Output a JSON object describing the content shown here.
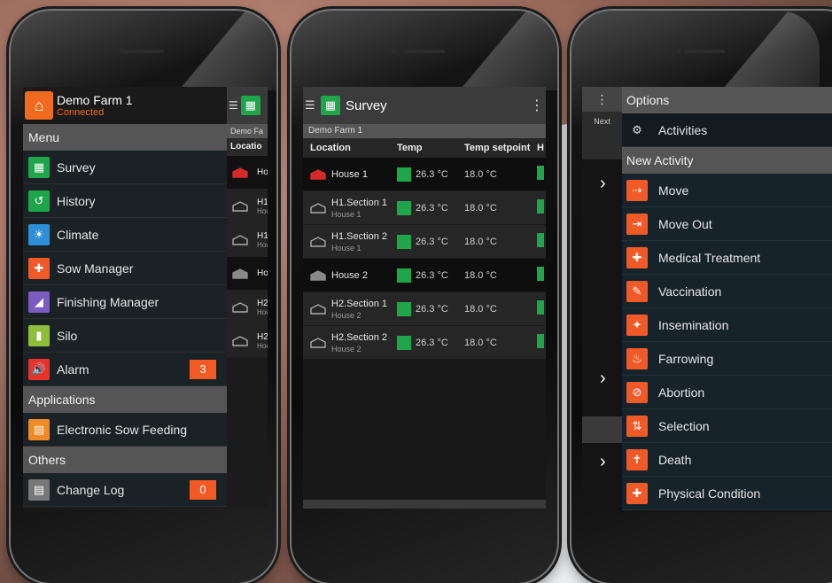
{
  "phone1": {
    "farm_name": "Demo Farm 1",
    "status": "Connected",
    "sections": [
      {
        "title": "Menu",
        "items": [
          {
            "label": "Survey",
            "icon": "grid-icon",
            "color": "#1fa64a"
          },
          {
            "label": "History",
            "icon": "history-icon",
            "color": "#1fa64a"
          },
          {
            "label": "Climate",
            "icon": "climate-icon",
            "color": "#2d8fd8"
          },
          {
            "label": "Sow Manager",
            "icon": "sow-icon",
            "color": "#f05a28"
          },
          {
            "label": "Finishing Manager",
            "icon": "finishing-icon",
            "color": "#7b5bbf"
          },
          {
            "label": "Silo",
            "icon": "silo-icon",
            "color": "#8fbf3a"
          },
          {
            "label": "Alarm",
            "icon": "alarm-icon",
            "color": "#e8322e",
            "badge": "3"
          }
        ]
      },
      {
        "title": "Applications",
        "items": [
          {
            "label": "Electronic Sow Feeding",
            "icon": "feeding-icon",
            "color": "#f08a24"
          }
        ]
      },
      {
        "title": "Others",
        "items": [
          {
            "label": "Change Log",
            "icon": "changelog-icon",
            "color": "#777777",
            "badge": "0"
          }
        ]
      }
    ],
    "peek": {
      "subtitle": "Demo Fa",
      "header": "Locatio",
      "rows": [
        {
          "name": "Ho",
          "sub": "",
          "type": "house-red"
        },
        {
          "name": "H1",
          "sub": "Hou",
          "type": "section"
        },
        {
          "name": "H1",
          "sub": "Hou",
          "type": "section"
        },
        {
          "name": "Ho",
          "sub": "",
          "type": "house-gray"
        },
        {
          "name": "H2",
          "sub": "Hou",
          "type": "section"
        },
        {
          "name": "H2",
          "sub": "Hou",
          "type": "section"
        }
      ]
    }
  },
  "phone2": {
    "title": "Survey",
    "farm": "Demo Farm 1",
    "columns": [
      "Location",
      "Temp",
      "Temp setpoint",
      "H"
    ],
    "rows": [
      {
        "name": "House 1",
        "sub": "",
        "temp": "26.3 °C",
        "setpoint": "18.0 °C",
        "type": "house-red"
      },
      {
        "name": "H1.Section 1",
        "sub": "House 1",
        "temp": "26.3 °C",
        "setpoint": "18.0 °C",
        "type": "section"
      },
      {
        "name": "H1.Section 2",
        "sub": "House 1",
        "temp": "26.3 °C",
        "setpoint": "18.0 °C",
        "type": "section"
      },
      {
        "name": "House 2",
        "sub": "",
        "temp": "26.3 °C",
        "setpoint": "18.0 °C",
        "type": "house-gray"
      },
      {
        "name": "H2.Section 1",
        "sub": "House 2",
        "temp": "26.3 °C",
        "setpoint": "18.0 °C",
        "type": "section"
      },
      {
        "name": "H2.Section 2",
        "sub": "House 2",
        "temp": "26.3 °C",
        "setpoint": "18.0 °C",
        "type": "section"
      }
    ]
  },
  "phone3": {
    "options_title": "Options",
    "next_label": "Next",
    "activities_label": "Activities",
    "new_activity_title": "New Activity",
    "activities": [
      {
        "label": "Move",
        "icon": "move-icon"
      },
      {
        "label": "Move Out",
        "icon": "move-out-icon"
      },
      {
        "label": "Medical Treatment",
        "icon": "medical-icon"
      },
      {
        "label": "Vaccination",
        "icon": "vaccination-icon"
      },
      {
        "label": "Insemination",
        "icon": "insemination-icon"
      },
      {
        "label": "Farrowing",
        "icon": "farrowing-icon"
      },
      {
        "label": "Abortion",
        "icon": "abortion-icon"
      },
      {
        "label": "Selection",
        "icon": "selection-icon"
      },
      {
        "label": "Death",
        "icon": "death-icon"
      },
      {
        "label": "Physical Condition",
        "icon": "physical-condition-icon"
      }
    ],
    "accent_color": "#f05a28"
  }
}
